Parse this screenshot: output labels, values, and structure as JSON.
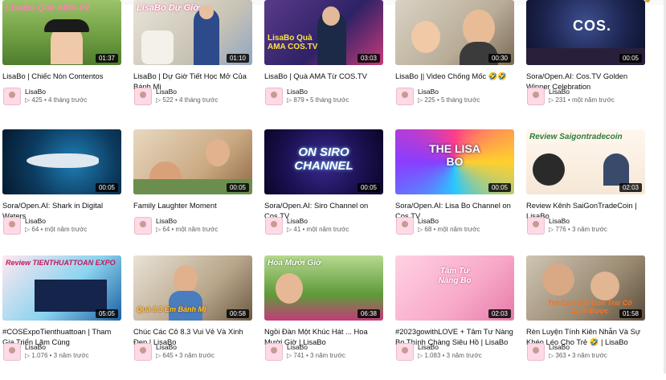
{
  "channel": "LisaBo",
  "videos": [
    {
      "title": "LisaBo | Chiếc Nón Contentos",
      "views": "425",
      "age": "4 tháng trước",
      "duration": "01:37",
      "overlay": "LisaBo Quà AMA P2"
    },
    {
      "title": "LisaBo | Dự Giờ Tiết Học Mở Của Bánh Mì",
      "views": "522",
      "age": "4 tháng trước",
      "duration": "01:10",
      "overlay": "LisaBo Dự Giờ"
    },
    {
      "title": "LisaBo | Quà AMA Từ COS.TV",
      "views": "879",
      "age": "5 tháng trước",
      "duration": "03:03",
      "overlay": "LisaBo Quà AMA COS.TV"
    },
    {
      "title": "LisaBo || Video Chống Mốc 🤣🤣",
      "views": "225",
      "age": "5 tháng trước",
      "duration": "00:30",
      "overlay": ""
    },
    {
      "title": "Sora/Open.AI: Cos.TV Golden Winner Celebration",
      "views": "231",
      "age": "một năm trước",
      "duration": "00:05",
      "overlay": "COS."
    },
    {
      "title": "Sora/Open.AI: Shark in Digital Waters",
      "views": "64",
      "age": "một năm trước",
      "duration": "00:05",
      "overlay": ""
    },
    {
      "title": "Family Laughter Moment",
      "views": "64",
      "age": "một năm trước",
      "duration": "00:05",
      "overlay": ""
    },
    {
      "title": "Sora/Open.AI: Siro Channel on Cos.TV",
      "views": "41",
      "age": "một năm trước",
      "duration": "00:05",
      "overlay": "ON SIRO CHANNEL"
    },
    {
      "title": "Sora/Open.AI: Lisa Bo Channel on Cos.TV",
      "views": "68",
      "age": "một năm trước",
      "duration": "00:05",
      "overlay": "THE LISA BO"
    },
    {
      "title": "Review Kênh SaiGonTradeCoin | LisaBo",
      "views": "776",
      "age": "3 năm trước",
      "duration": "02:03",
      "overlay": "Review Saigontradecoin"
    },
    {
      "title": "#COSExpoTienthuattoan | Tham Gia Triển Lãm Cùng TIENTHUATTO...",
      "views": "1.076",
      "age": "3 năm trước",
      "duration": "05:05",
      "overlay": "Review TIENTHUATTOAN EXPO"
    },
    {
      "title": "Chúc Các Cô 8.3 Vui Vẻ Và Xinh Đẹp | LisaBo",
      "views": "645",
      "age": "3 năm trước",
      "duration": "00:58",
      "overlay": "Quà 8.3 Em Bánh Mì"
    },
    {
      "title": "Ngồi Đàn Một Khúc Hát ... Hoa Mười Giờ | LisaBo",
      "views": "741",
      "age": "3 năm trước",
      "duration": "06:38",
      "overlay": "Hoa Mười Giờ"
    },
    {
      "title": "#2023gowithLOVE + Tâm Tư Nàng Bo Thính Chàng Siêu Hồ | LisaBo",
      "views": "1.083",
      "age": "3 năm trước",
      "duration": "02:03",
      "overlay": "Tâm Tư Nàng Bo"
    },
    {
      "title": "Rèn Luyện Tính Kiên Nhẫn Và Sự Khéo Léo Cho Trẻ 🤣 | LisaBo",
      "views": "363",
      "age": "3 năm trước",
      "duration": "01:58",
      "overlay": "Trò Con Gà! Con Trai Cô Chơi Được"
    }
  ],
  "colors": {
    "text": "#0f0f0f",
    "meta": "#606060",
    "duration_bg": "#000000",
    "avatar_bg": "#ffd9e6"
  }
}
